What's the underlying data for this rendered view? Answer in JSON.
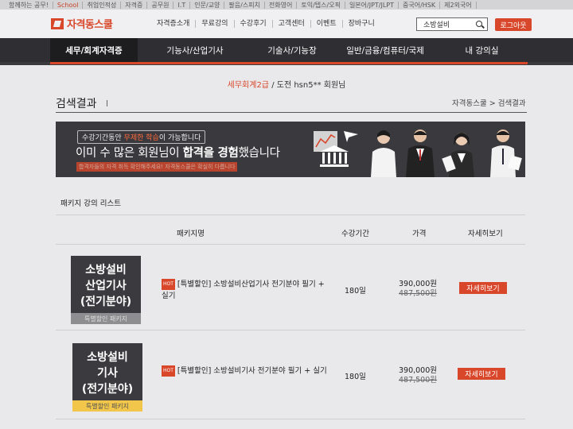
{
  "topbar": {
    "items": [
      "함께하는 공무!",
      "School",
      "취업인적성",
      "자격증",
      "공무원",
      "I.T",
      "인문/교양",
      "팔음/스피치",
      "전화영어",
      "토익/텝스/오픽",
      "일본어/JPT/JLPT",
      "중국어/HSK",
      "제2외국어"
    ]
  },
  "header": {
    "logo": "자격동스쿨",
    "nav": [
      "자격증소개",
      "무료강의",
      "수강후기",
      "고객센터",
      "이벤트",
      "장바구니"
    ],
    "search_value": "소방설비",
    "logout_label": "로그아웃"
  },
  "categories": [
    "세무/회계자격증",
    "기능사/산업기사",
    "기술사/기능장",
    "일반/금융/컴퓨터/국제",
    "내 강의실"
  ],
  "welcome": {
    "grade": "세무회계2급",
    "rest": "/ 도전 hsn5** 회원님"
  },
  "page": {
    "title": "검색결과",
    "breadcrumb": "자격동스쿨 > 검색결과"
  },
  "banner": {
    "pill_prefix": "수강기간동안 ",
    "pill_highlight": "무제한 학습",
    "pill_suffix": "이 가능합니다",
    "main_prefix": "이미 수 많은 회원님이 ",
    "main_bold": "합격을 경험",
    "main_suffix": "했습니다",
    "note": "합격자들의 자격 취득 확인해주세요! 자격동스쿨은 확실히 다릅니다"
  },
  "package_list": {
    "title": "패키지 강의 리스트",
    "headers": {
      "name": "패키지명",
      "period": "수강기간",
      "price": "가격",
      "detail": "자세히보기"
    },
    "rows": [
      {
        "thumb_title": "소방설비\n산업기사\n(전기분야)",
        "thumb_tag": "특별할인 패키지",
        "badge": "HOT",
        "name": "[특별할인] 소방설비산업기사 전기분야 필기 + 실기",
        "period": "180일",
        "price": "390,000원",
        "orig_price": "487,500원",
        "detail": "자세히보기"
      },
      {
        "thumb_title": "소방설비\n기사\n(전기분야)",
        "thumb_tag": "특별할인 패키지",
        "badge": "HOT",
        "name": "[특별할인] 소방설비기사 전기분야 필기 + 실기",
        "period": "180일",
        "price": "390,000원",
        "orig_price": "487,500원",
        "detail": "자세히보기"
      }
    ]
  },
  "colors": {
    "accent": "#d9472b",
    "dark_nav": "#2f2f33",
    "banner_bg": "#3a3a3e"
  }
}
